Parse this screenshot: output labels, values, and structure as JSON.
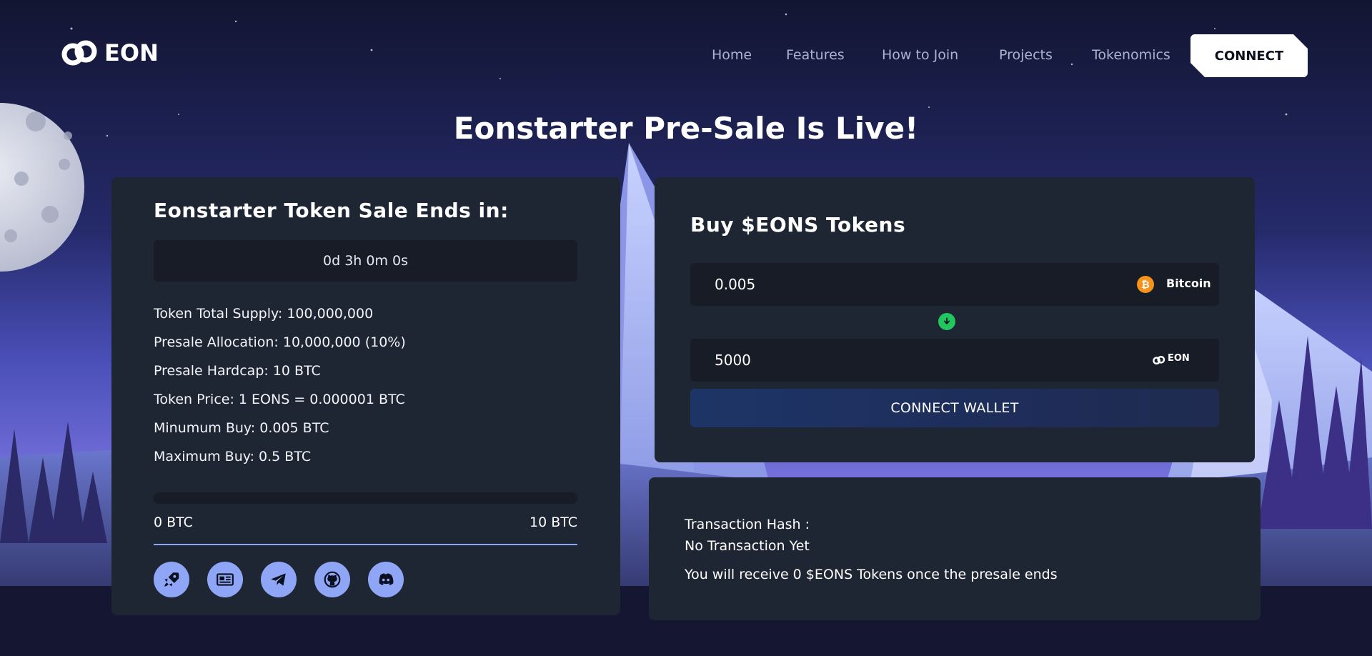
{
  "brand": {
    "name": "EON"
  },
  "nav": {
    "items": [
      "Home",
      "Features",
      "How to Join",
      "Projects",
      "Tokenomics"
    ],
    "connect_label": "CONNECT"
  },
  "hero": {
    "title": "Eonstarter Pre-Sale Is Live!"
  },
  "sale": {
    "title": "Eonstarter Token Sale Ends in:",
    "countdown": "0d 3h 0m 0s",
    "info": [
      "Token Total Supply: 100,000,000",
      "Presale Allocation: 10,000,000 (10%)",
      "Presale Hardcap: 10 BTC",
      "Token Price: 1 EONS = 0.000001 BTC",
      "Minumum Buy: 0.005 BTC",
      "Maximum Buy: 0.5 BTC"
    ],
    "progress": {
      "raised_fraction": 0,
      "min_label": "0 BTC",
      "max_label": "10 BTC"
    },
    "socials": [
      "rocket-icon",
      "news-icon",
      "telegram-icon",
      "github-icon",
      "discord-icon"
    ]
  },
  "buy": {
    "title": "Buy $EONS Tokens",
    "pay_amount": "0.005",
    "pay_currency": "Bitcoin",
    "receive_amount": "5000",
    "receive_currency": "EON",
    "wallet_button": "CONNECT WALLET"
  },
  "transaction": {
    "hash_label": "Transaction Hash :",
    "hash_value": "No Transaction Yet",
    "receive_text": "You will receive 0 $EONS Tokens once the presale ends"
  },
  "colors": {
    "panel": "#1e2533",
    "field": "#171c26",
    "accent": "#8fa6f7",
    "swap": "#22c55e",
    "bitcoin": "#f7931a"
  }
}
